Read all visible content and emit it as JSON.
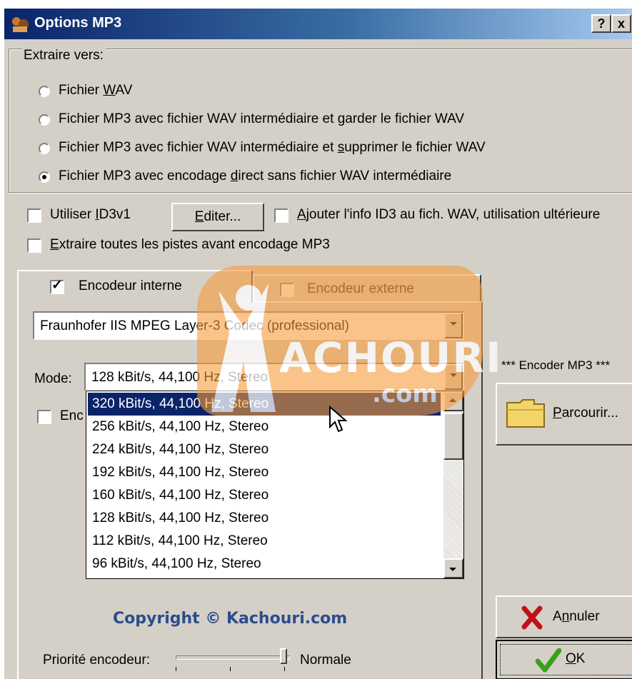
{
  "window": {
    "title": "Options MP3",
    "help_label": "?",
    "close_label": "x"
  },
  "extract": {
    "legend": "Extraire vers:",
    "options": [
      {
        "pre": "Fichier ",
        "ul": "W",
        "post": "AV",
        "selected": false
      },
      {
        "pre": "Fichier MP3 avec fichier WAV intermédiaire et ",
        "ul": "g",
        "post": "arder le fichier WAV",
        "selected": false
      },
      {
        "pre": "Fichier MP3 avec fichier WAV intermédiaire et ",
        "ul": "s",
        "post": "upprimer le fichier WAV",
        "selected": false
      },
      {
        "pre": "Fichier MP3 avec encodage ",
        "ul": "d",
        "post": "irect sans fichier WAV intermédiaire",
        "selected": true
      }
    ]
  },
  "id3": {
    "use_id3v1": {
      "pre": "Utiliser ",
      "ul": "I",
      "post": "D3v1",
      "checked": false
    },
    "edit_button": {
      "pre": "",
      "ul": "E",
      "post": "diter..."
    },
    "add_id3_wav": {
      "pre": "",
      "ul": "A",
      "post": "jouter l'info ID3 au fich. WAV, utilisation ultérieure",
      "checked": false
    },
    "extract_all": {
      "pre": "",
      "ul": "E",
      "post": "xtraire toutes les pistes avant encodage MP3",
      "checked": false
    }
  },
  "tabs": [
    {
      "label": "Encodeur interne",
      "checked": true
    },
    {
      "label": "Encodeur externe",
      "checked": false
    }
  ],
  "codec": {
    "value": "Fraunhofer IIS MPEG Layer-3 Codec (professional)"
  },
  "mode": {
    "label": "Mode:",
    "value": "128 kBit/s, 44,100 Hz, Stereo",
    "options": [
      "320 kBit/s, 44,100 Hz, Stereo",
      "256 kBit/s, 44,100 Hz, Stereo",
      "224 kBit/s, 44,100 Hz, Stereo",
      "192 kBit/s, 44,100 Hz, Stereo",
      "160 kBit/s, 44,100 Hz, Stereo",
      "128 kBit/s, 44,100 Hz, Stereo",
      "112 kBit/s, 44,100 Hz, Stereo",
      "96 kBit/s, 44,100 Hz, Stereo"
    ],
    "highlighted_index": 0
  },
  "hidden_checkbox_label": "Enc",
  "watermark": {
    "text": "ACHOURI",
    "com": ".com"
  },
  "copyright": "Copyright © Kachouri.com",
  "priority": {
    "label": "Priorité encodeur:",
    "value_label": "Normale"
  },
  "encoder_mp3": {
    "label": "*** Encoder MP3 ***",
    "browse_button": {
      "pre": "",
      "ul": "P",
      "post": "arcourir..."
    }
  },
  "cancel_button": {
    "pre": "A",
    "ul": "n",
    "post": "nuler"
  },
  "ok_button": {
    "pre": "",
    "ul": "O",
    "post": "K"
  },
  "colors": {
    "titlebar": "#0a246a",
    "selection": "#0a246a",
    "dialog": "#d4d0c8",
    "watermark": "#f59b3a",
    "copyright": "#2b4d8c"
  }
}
